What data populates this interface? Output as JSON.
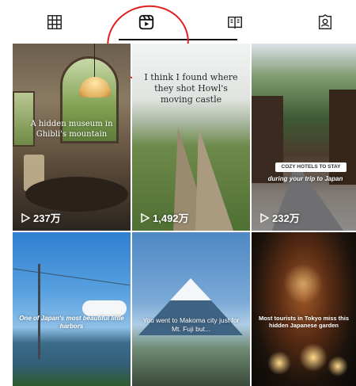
{
  "tabs": [
    {
      "icon": "grid-icon",
      "label": "Posts"
    },
    {
      "icon": "reels-icon",
      "label": "Reels"
    },
    {
      "icon": "guides-icon",
      "label": "Guides"
    },
    {
      "icon": "tagged-icon",
      "label": "Tagged"
    }
  ],
  "active_tab": 1,
  "tiles": [
    {
      "caption": "A hidden museum in Ghibli's mountain",
      "views": "237万"
    },
    {
      "caption": "I think I found where they shot Howl's moving castle",
      "views": "1,492万"
    },
    {
      "badge": "COZY HOTELS TO STAY",
      "caption": "during your trip to Japan",
      "views": "232万"
    },
    {
      "caption": "One of Japan's most beautiful little harbors",
      "views": ""
    },
    {
      "caption": "You went to Makoma city just for Mt. Fuji but...",
      "views": ""
    },
    {
      "caption": "Most tourists in Tokyo miss this hidden Japanese garden",
      "views": ""
    }
  ],
  "colors": {
    "annotation": "#e02020",
    "active_indicator": "#111111"
  }
}
